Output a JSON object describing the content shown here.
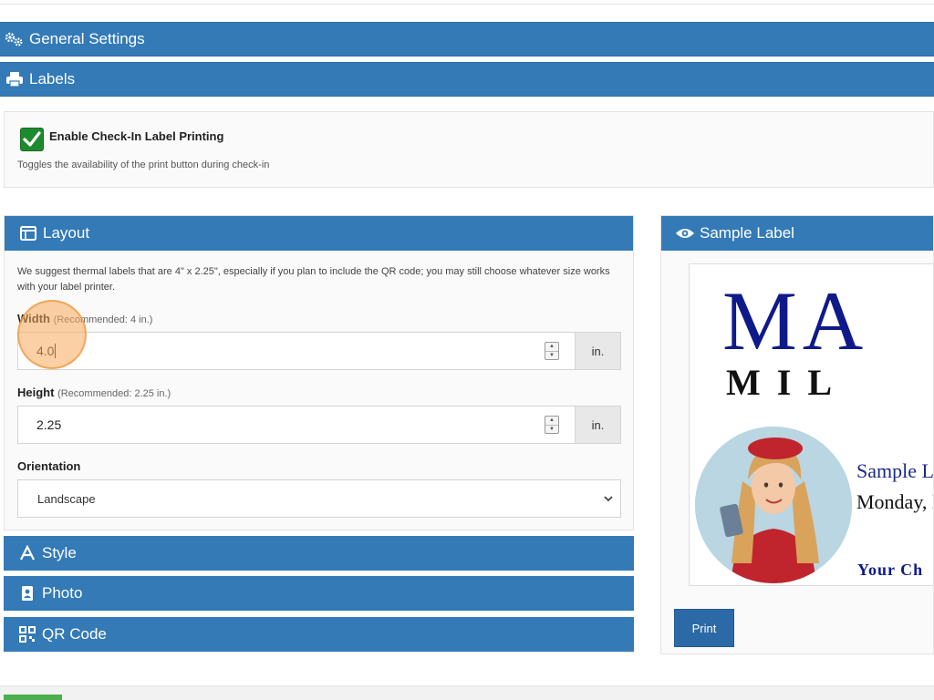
{
  "sections": {
    "general_settings": "General Settings",
    "labels": "Labels",
    "style": "Style",
    "photo": "Photo",
    "qr_code": "QR Code"
  },
  "enable": {
    "label": "Enable Check-In Label Printing",
    "help": "Toggles the availability of the print button during check-in",
    "checked": true
  },
  "layout": {
    "title": "Layout",
    "suggestion": "We suggest thermal labels that are 4\" x 2.25\", especially if you plan to include the QR code; you may still choose whatever size works with your label printer.",
    "width": {
      "label": "Width",
      "recommended": "(Recommended: 4 in.)",
      "value": "4.0",
      "unit": "in."
    },
    "height": {
      "label": "Height",
      "recommended": "(Recommended: 2.25 in.)",
      "value": "2.25",
      "unit": "in."
    },
    "orientation": {
      "label": "Orientation",
      "selected": "Landscape"
    }
  },
  "sample": {
    "title": "Sample Label",
    "big_text": "MA",
    "sub_text": "MIL",
    "name": "Sample Lab",
    "date": "Monday, M",
    "footer": "Your Ch",
    "print_label": "Print"
  },
  "colors": {
    "bar": "#337ab7",
    "check": "#1e8a2e",
    "label_navy": "#0f1a8a"
  }
}
